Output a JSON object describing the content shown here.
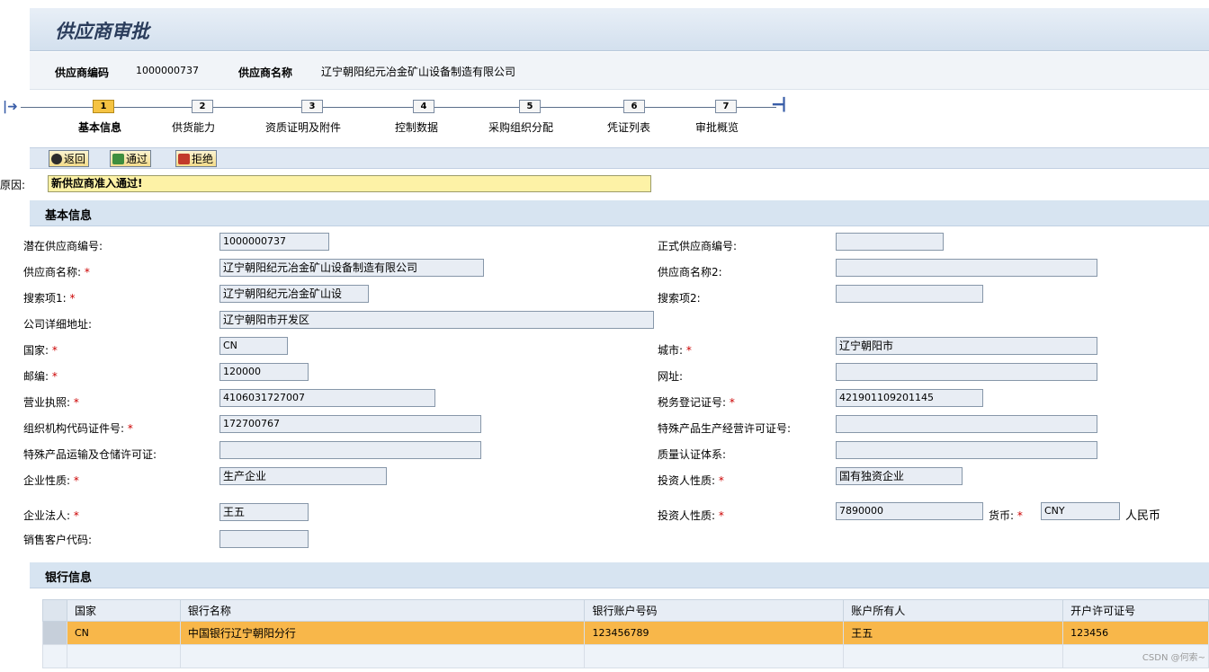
{
  "page_title": "供应商审批",
  "header": {
    "vendor_code_label": "供应商编码",
    "vendor_code": "1000000737",
    "vendor_name_label": "供应商名称",
    "vendor_name": "辽宁朝阳纪元冶金矿山设备制造有限公司"
  },
  "roadmap": {
    "steps": [
      {
        "num": "1",
        "label": "基本信息",
        "active": true
      },
      {
        "num": "2",
        "label": "供货能力"
      },
      {
        "num": "3",
        "label": "资质证明及附件"
      },
      {
        "num": "4",
        "label": "控制数据"
      },
      {
        "num": "5",
        "label": "采购组织分配"
      },
      {
        "num": "6",
        "label": "凭证列表"
      },
      {
        "num": "7",
        "label": "审批概览"
      }
    ]
  },
  "toolbar": {
    "back_label": "返回",
    "approve_label": "通过",
    "reject_label": "拒绝"
  },
  "reason": {
    "label": "原因:",
    "value": "新供应商准入通过!"
  },
  "basic_section_title": "基本信息",
  "fields": {
    "potential_vendor_no_label": "潜在供应商编号:",
    "potential_vendor_no": "1000000737",
    "vendor_name_label": "供应商名称:",
    "vendor_name": "辽宁朝阳纪元冶金矿山设备制造有限公司",
    "search_term1_label": "搜索项1:",
    "search_term1": "辽宁朝阳纪元冶金矿山设",
    "address_label": "公司详细地址:",
    "address": "辽宁朝阳市开发区",
    "country_label": "国家:",
    "country": "CN",
    "postcode_label": "邮编:",
    "postcode": "120000",
    "license_label": "营业执照:",
    "license": "4106031727007",
    "org_code_label": "组织机构代码证件号:",
    "org_code": "172700767",
    "transport_permit_label": "特殊产品运输及仓储许可证:",
    "transport_permit": "",
    "enterprise_type_label": "企业性质:",
    "enterprise_type": "生产企业",
    "legal_person_label": "企业法人:",
    "legal_person": "王五",
    "sales_customer_code_label": "销售客户代码:",
    "sales_customer_code": "",
    "formal_vendor_no_label": "正式供应商编号:",
    "formal_vendor_no": "",
    "vendor_name2_label": "供应商名称2:",
    "vendor_name2": "",
    "search_term2_label": "搜索项2:",
    "search_term2": "",
    "city_label": "城市:",
    "city": "辽宁朝阳市",
    "website_label": "网址:",
    "website": "",
    "tax_reg_label": "税务登记证号:",
    "tax_reg": "421901109201145",
    "production_permit_label": "特殊产品生产经营许可证号:",
    "production_permit": "",
    "quality_system_label": "质量认证体系:",
    "quality_system": "",
    "investor_type_label": "投资人性质:",
    "investor_type": "国有独资企业",
    "capital_label": "投资人性质:",
    "capital": "7890000",
    "currency_label": "货币:",
    "currency": "CNY",
    "currency_name": "人民币"
  },
  "bank_section_title": "银行信息",
  "bank_table": {
    "columns": [
      "国家",
      "银行名称",
      "银行账户号码",
      "账户所有人",
      "开户许可证号"
    ],
    "rows": [
      [
        "CN",
        "中国银行辽宁朝阳分行",
        "123456789",
        "王五",
        "123456"
      ]
    ]
  },
  "watermark": "CSDN @何索~"
}
